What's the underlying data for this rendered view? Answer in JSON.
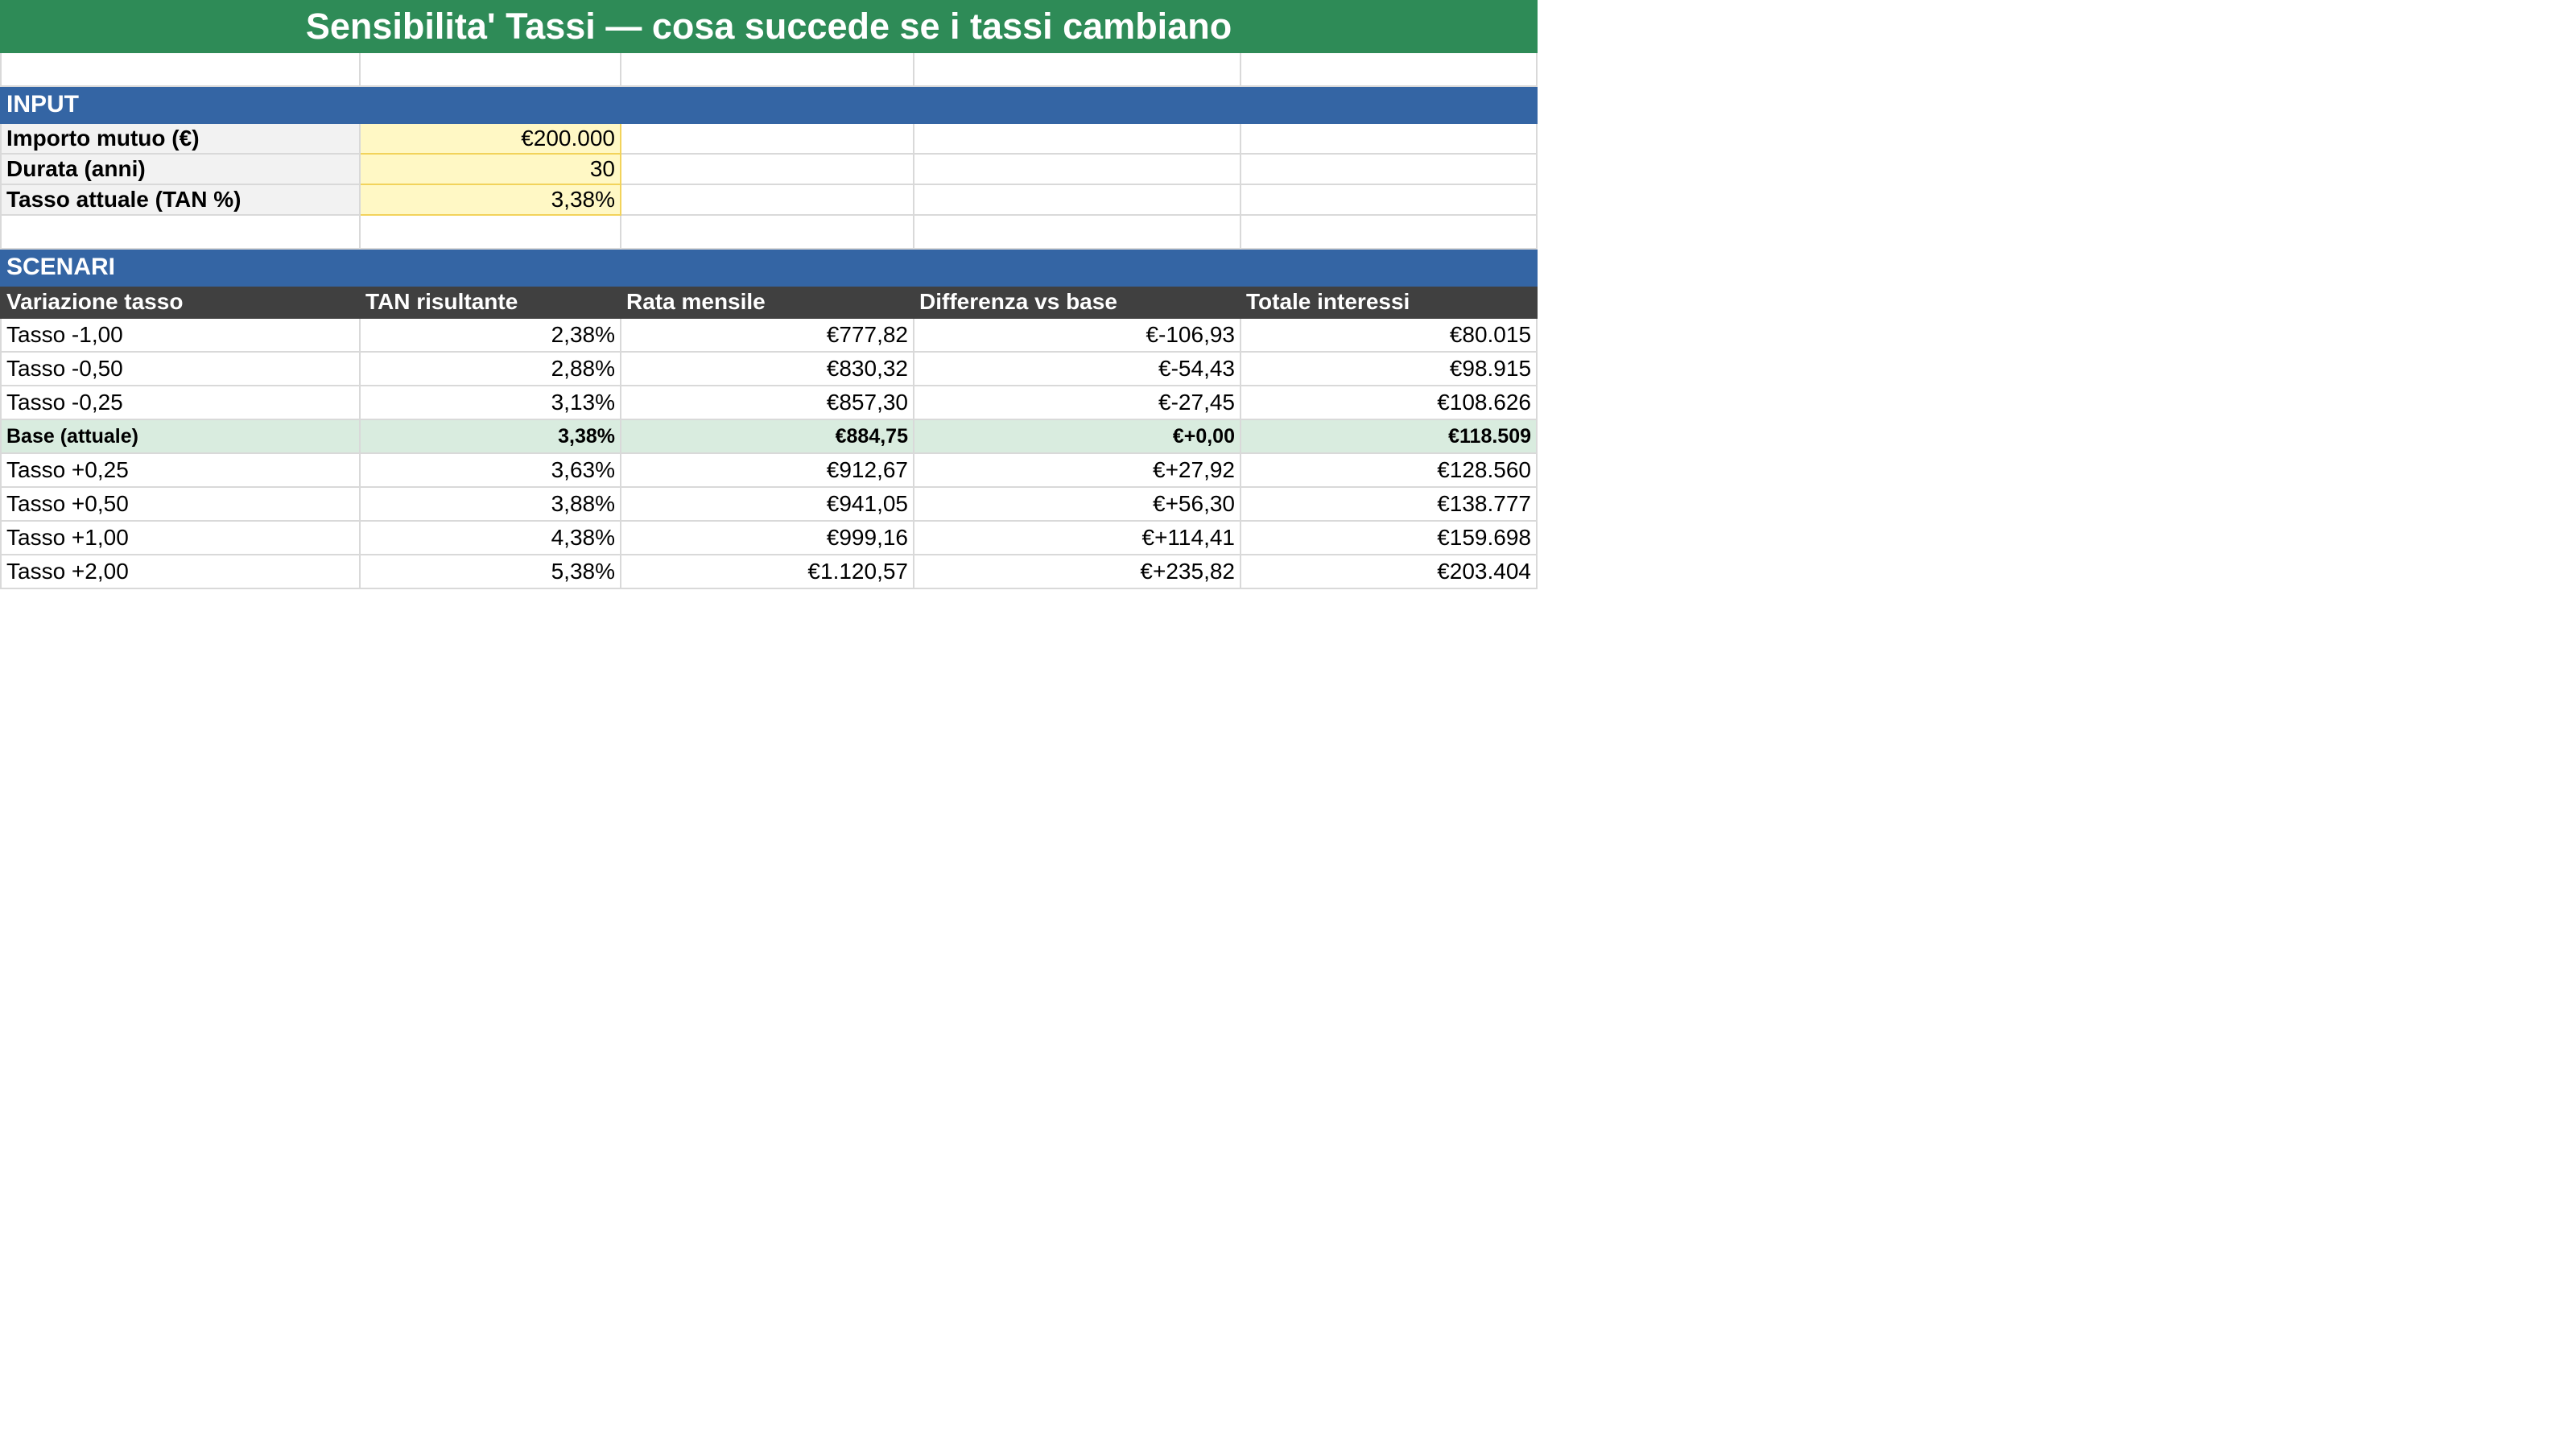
{
  "title": "Sensibilita' Tassi — cosa succede se i tassi cambiano",
  "input_section": {
    "label": "INPUT",
    "rows": [
      {
        "label": "Importo mutuo (€)",
        "value": "€200.000"
      },
      {
        "label": "Durata (anni)",
        "value": "30"
      },
      {
        "label": "Tasso attuale (TAN %)",
        "value": "3,38%"
      }
    ]
  },
  "scenari_section": {
    "label": "SCENARI",
    "headers": [
      "Variazione tasso",
      "TAN risultante",
      "Rata mensile",
      "Differenza vs base",
      "Totale interessi"
    ],
    "rows": [
      {
        "variazione": "Tasso -1,00",
        "tan": "2,38%",
        "rata": "€777,82",
        "differenza": "€-106,93",
        "interessi": "€80.015"
      },
      {
        "variazione": "Tasso -0,50",
        "tan": "2,88%",
        "rata": "€830,32",
        "differenza": "€-54,43",
        "interessi": "€98.915"
      },
      {
        "variazione": "Tasso -0,25",
        "tan": "3,13%",
        "rata": "€857,30",
        "differenza": "€-27,45",
        "interessi": "€108.626"
      },
      {
        "variazione": "Base (attuale)",
        "tan": "3,38%",
        "rata": "€884,75",
        "differenza": "€+0,00",
        "interessi": "€118.509"
      },
      {
        "variazione": "Tasso +0,25",
        "tan": "3,63%",
        "rata": "€912,67",
        "differenza": "€+27,92",
        "interessi": "€128.560"
      },
      {
        "variazione": "Tasso +0,50",
        "tan": "3,88%",
        "rata": "€941,05",
        "differenza": "€+56,30",
        "interessi": "€138.777"
      },
      {
        "variazione": "Tasso +1,00",
        "tan": "4,38%",
        "rata": "€999,16",
        "differenza": "€+114,41",
        "interessi": "€159.698"
      },
      {
        "variazione": "Tasso +2,00",
        "tan": "5,38%",
        "rata": "€1.120,57",
        "differenza": "€+235,82",
        "interessi": "€203.404"
      }
    ]
  },
  "colors": {
    "title_bg": "#2e8b57",
    "section_bg": "#3465a4",
    "header_bg": "#404040",
    "input_value_bg": "#fff8c5",
    "base_row_bg": "#d9ecdf"
  }
}
